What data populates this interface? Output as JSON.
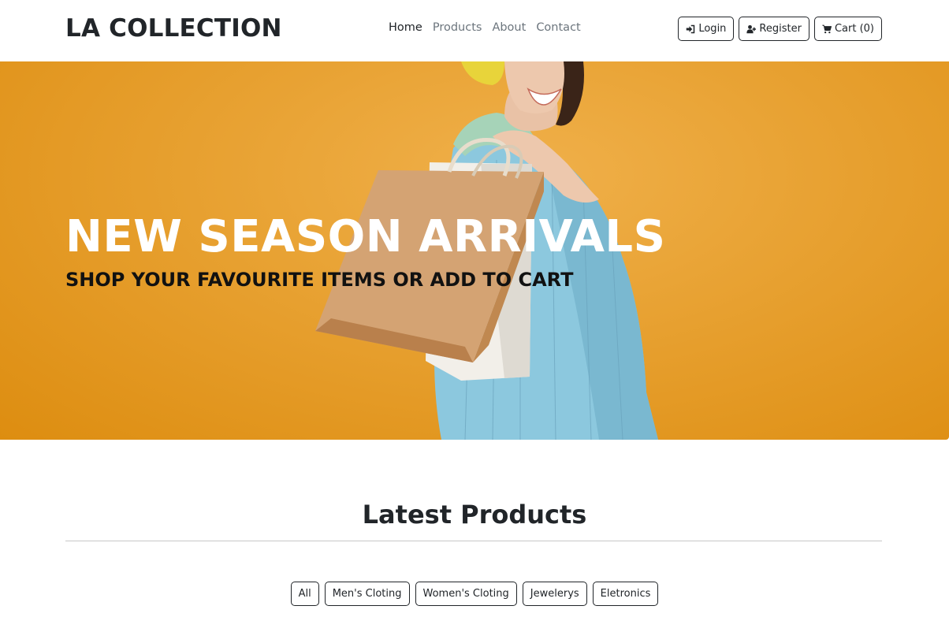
{
  "brand": "LA COLLECTION",
  "nav": {
    "links": [
      "Home",
      "Products",
      "About",
      "Contact"
    ],
    "active": "Home",
    "login_label": "Login",
    "register_label": "Register",
    "cart_label": "Cart (0)"
  },
  "hero": {
    "title": "NEW SEASON ARRIVALS",
    "subtitle": "SHOP YOUR FAVOURITE ITEMS OR ADD TO CART"
  },
  "products": {
    "title": "Latest Products",
    "filters": [
      "All",
      "Men's Cloting",
      "Women's Cloting",
      "Jewelerys",
      "Eletronics"
    ]
  },
  "colors": {
    "accent": "#212529",
    "hero_bg": "#e8a233"
  },
  "icons": {
    "login": "sign-in-icon",
    "register": "user-plus-icon",
    "cart": "shopping-cart-icon"
  }
}
